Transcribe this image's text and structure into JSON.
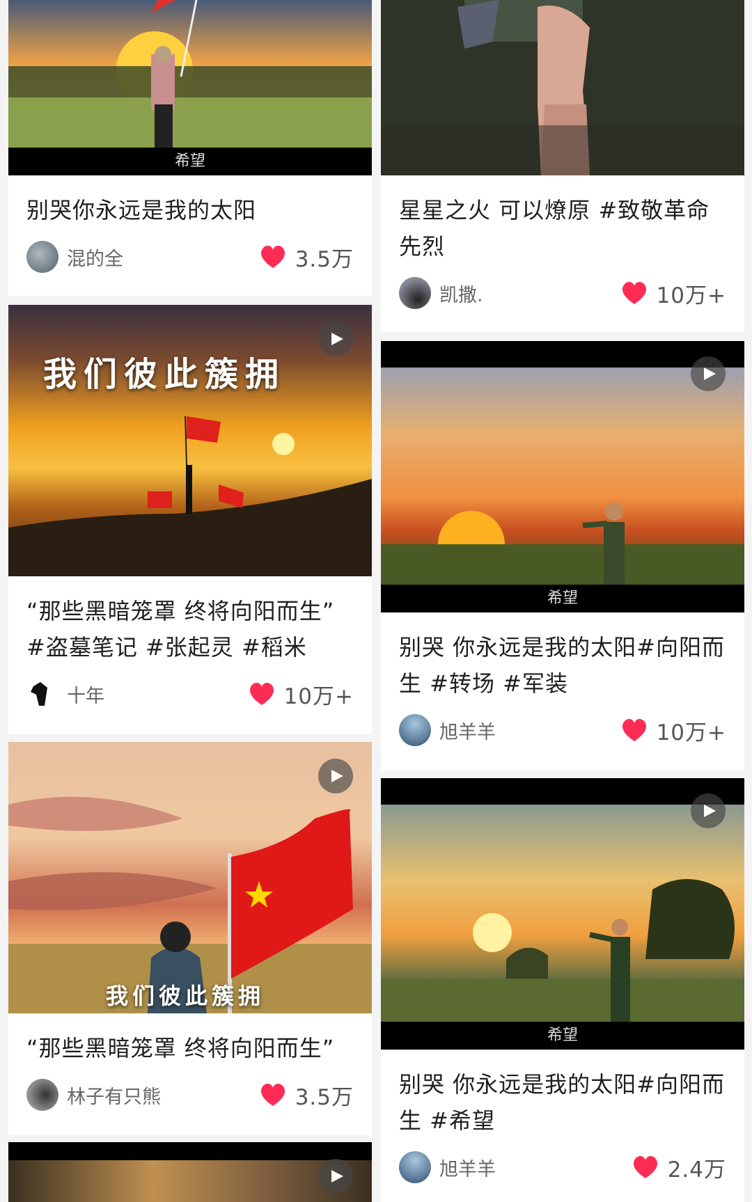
{
  "feed": {
    "cards": [
      {
        "title": "别哭你永远是我的太阳",
        "author": "混的全",
        "likes": "3.5万",
        "caption": "希望"
      },
      {
        "title": "星星之火 可以燎原 #致敬革命先烈",
        "author": "凯撒.",
        "likes": "10万+"
      },
      {
        "title": "“那些黑暗笼罩 终将向阳而生” #盗墓笔记 #张起灵 #稻米",
        "author": "十年",
        "likes": "10万+",
        "overlay": "我们彼此簇拥"
      },
      {
        "title": "别哭 你永远是我的太阳#向阳而生 #转场 #军装",
        "author": "旭羊羊",
        "likes": "10万+",
        "caption": "希望"
      },
      {
        "title": "“那些黑暗笼罩 终将向阳而生”",
        "author": "林子有只熊",
        "likes": "3.5万",
        "overlay": "我们彼此簇拥"
      },
      {
        "title": "别哭 你永远是我的太阳#向阳而生 #希望",
        "author": "旭羊羊",
        "likes": "2.4万",
        "caption": "希望"
      }
    ]
  },
  "icons": {
    "heart": "heart-icon",
    "play": "play-icon"
  },
  "colors": {
    "heart": "#fe2c55",
    "card_bg": "#ffffff",
    "page_bg": "#f4f4f4"
  }
}
